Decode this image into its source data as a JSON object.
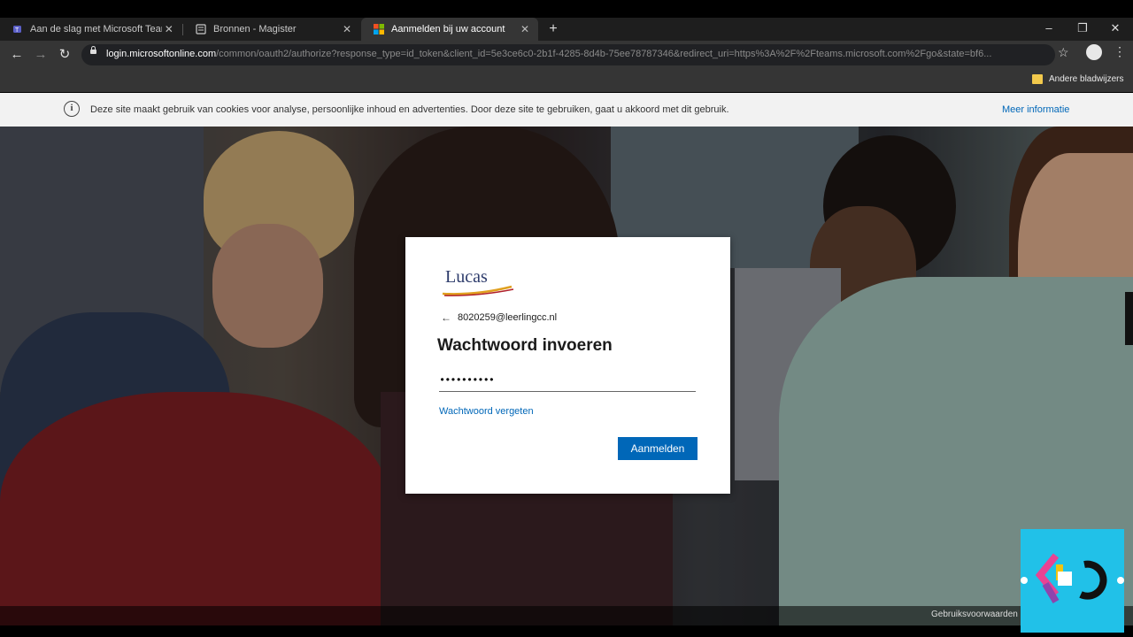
{
  "browser": {
    "tabs": [
      {
        "title": "Aan de slag met Microsoft Teams",
        "icon": "teams-icon",
        "active": false
      },
      {
        "title": "Bronnen - Magister",
        "icon": "magister-icon",
        "active": false
      },
      {
        "title": "Aanmelden bij uw account",
        "icon": "microsoft-icon",
        "active": true
      }
    ],
    "new_tab": "+",
    "window_controls": {
      "minimize": "–",
      "restore": "❐",
      "close": "✕"
    },
    "url_host": "login.microsoftonline.com",
    "url_rest": "/common/oauth2/authorize?response_type=id_token&client_id=5e3ce6c0-2b1f-4285-8d4b-75ee78787346&redirect_uri=https%3A%2F%2Fteams.microsoft.com%2Fgo&state=bf6...",
    "bookmarks_label": "Andere bladwijzers"
  },
  "cookie_bar": {
    "text": "Deze site maakt gebruik van cookies voor analyse, persoonlijke inhoud en advertenties. Door deze site te gebruiken, gaat u akkoord met dit gebruik.",
    "link": "Meer informatie"
  },
  "login": {
    "logo_text": "Lucas",
    "identity": "8020259@leerlingcc.nl",
    "heading": "Wachtwoord invoeren",
    "password_value": "••••••••••",
    "forgot_link": "Wachtwoord vergeten",
    "signin_button": "Aanmelden"
  },
  "footer": {
    "terms_link": "Gebruiksvoorwaarden"
  },
  "colors": {
    "accent": "#0067b8",
    "overlay_logo_bg": "#21c1e8"
  }
}
